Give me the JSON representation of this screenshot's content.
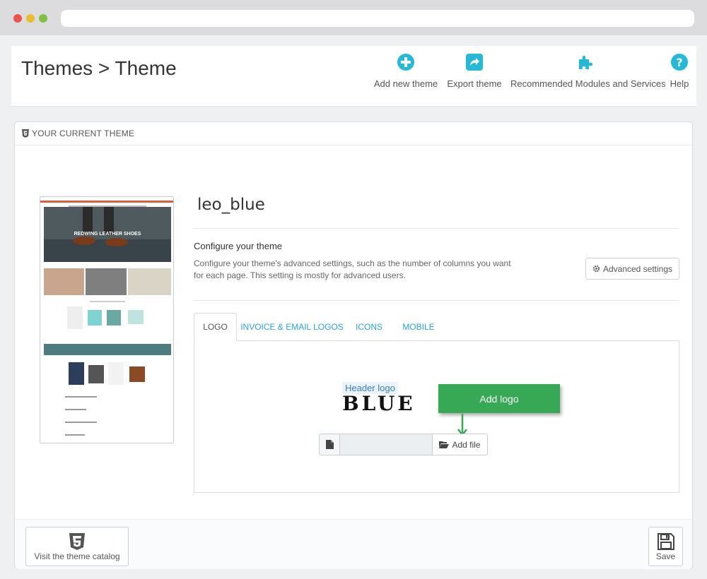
{
  "header": {
    "title": "Themes > Theme",
    "toolbar": [
      {
        "label": "Add new theme",
        "icon": "plus-circle-icon"
      },
      {
        "label": "Export theme",
        "icon": "share-square-icon"
      },
      {
        "label": "Recommended Modules and Services",
        "icon": "puzzle-icon"
      },
      {
        "label": "Help",
        "icon": "question-circle-icon"
      }
    ],
    "accent_color": "#25b9d7"
  },
  "panel": {
    "heading": "YOUR CURRENT THEME",
    "theme_name": "leo_blue",
    "config_title": "Configure your theme",
    "config_desc": "Configure your theme's advanced settings, such as the number of columns you want for each page. This setting is mostly for advanced users.",
    "advanced_button": "Advanced settings",
    "tabs": [
      "LOGO",
      "INVOICE & EMAIL LOGOS",
      "ICONS",
      "MOBILE"
    ],
    "active_tab": "LOGO",
    "logo_tab": {
      "header_logo_label": "Header logo",
      "logo_text": "BLUE",
      "callout": "Add logo",
      "add_file_button": "Add file"
    },
    "preview": {
      "banner_text": "REDWING LEATHER SHOES",
      "banner_color": "#e05d3f"
    }
  },
  "footer": {
    "catalog_button": "Visit the theme catalog",
    "save_button": "Save"
  },
  "colors": {
    "link": "#26a3e0",
    "callout_green": "#37a856"
  }
}
